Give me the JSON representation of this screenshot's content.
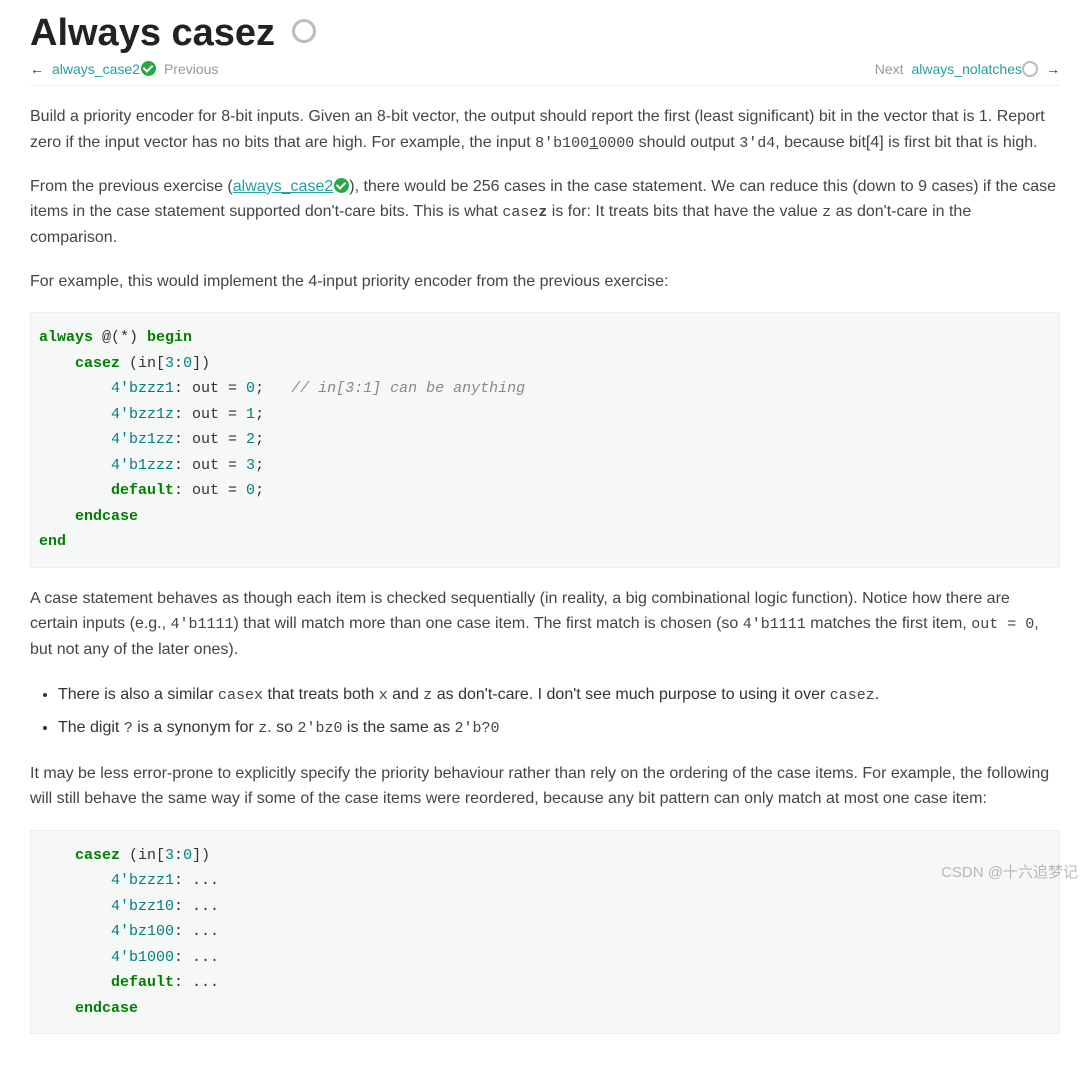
{
  "header": {
    "title": "Always casez"
  },
  "nav": {
    "prev_link": "always_case2",
    "prev_label": "Previous",
    "next_label": "Next",
    "next_link": "always_nolatches"
  },
  "paragraphs": {
    "p1_a": "Build a priority encoder for 8-bit inputs. Given an 8-bit vector, the output should report the first (least significant) bit in the vector that is 1. Report zero if the input vector has no bits that are high. For example, the input ",
    "p1_code1": "8'b100",
    "p1_code2": "1",
    "p1_code3": "0000",
    "p1_b": " should output ",
    "p1_code4": "3'd4",
    "p1_c": ", because bit[4] is first bit that is high.",
    "p2_a": "From the previous exercise (",
    "p2_link": "always_case2",
    "p2_b": "), there would be 256 cases in the case statement. We can reduce this (down to 9 cases) if the case items in the case statement supported don't-care bits. This is what ",
    "p2_code1": "case",
    "p2_code2": "z",
    "p2_c": " is for: It treats bits that have the value ",
    "p2_code3": "z",
    "p2_d": " as don't-care in the comparison.",
    "p3": "For example, this would implement the 4-input priority encoder from the previous exercise:",
    "p4_a": "A case statement behaves as though each item is checked sequentially (in reality, a big combinational logic function). Notice how there are certain inputs (e.g., ",
    "p4_code1": "4'b1111",
    "p4_b": ") that will match more than one case item. The first match is chosen (so ",
    "p4_code2": "4'b1111",
    "p4_c": " matches the first item, ",
    "p4_code3": "out = 0",
    "p4_d": ", but not any of the later ones).",
    "li1_a": "There is also a similar ",
    "li1_code1": "casex",
    "li1_b": " that treats both ",
    "li1_code2": "x",
    "li1_c": " and ",
    "li1_code3": "z",
    "li1_d": " as don't-care. I don't see much purpose to using it over ",
    "li1_code4": "casez",
    "li1_e": ".",
    "li2_a": "The digit ",
    "li2_code1": "?",
    "li2_b": " is a synonym for ",
    "li2_code2": "z",
    "li2_c": ". so ",
    "li2_code3": "2'bz0",
    "li2_d": " is the same as ",
    "li2_code4": "2'b?0",
    "p5": "It may be less error-prone to explicitly specify the priority behaviour rather than rely on the ordering of the case items. For example, the following will still behave the same way if some of the case items were reordered, because any bit pattern can only match at most one case item:"
  },
  "code1": {
    "l1_a": "always",
    "l1_b": " @(*) ",
    "l1_c": "begin",
    "l2_a": "    casez",
    "l2_b": " (in[",
    "l2_c": "3",
    "l2_d": ":",
    "l2_e": "0",
    "l2_f": "])",
    "l3_a": "        4'bzzz1",
    "l3_b": ": out = ",
    "l3_c": "0",
    "l3_d": ";   ",
    "l3_e": "// in[3:1] can be anything",
    "l4_a": "        4'bzz1z",
    "l4_b": ": out = ",
    "l4_c": "1",
    "l4_d": ";",
    "l5_a": "        4'bz1zz",
    "l5_b": ": out = ",
    "l5_c": "2",
    "l5_d": ";",
    "l6_a": "        4'b1zzz",
    "l6_b": ": out = ",
    "l6_c": "3",
    "l6_d": ";",
    "l7_a": "        default",
    "l7_b": ": out = ",
    "l7_c": "0",
    "l7_d": ";",
    "l8": "    endcase",
    "l9": "end"
  },
  "code2": {
    "l1_a": "    casez",
    "l1_b": " (in[",
    "l1_c": "3",
    "l1_d": ":",
    "l1_e": "0",
    "l1_f": "])",
    "l2_a": "        4'bzzz1",
    "l2_b": ": ...",
    "l3_a": "        4'bzz10",
    "l3_b": ": ...",
    "l4_a": "        4'bz100",
    "l4_b": ": ...",
    "l5_a": "        4'b1000",
    "l5_b": ": ...",
    "l6_a": "        default",
    "l6_b": ": ...",
    "l7": "    endcase"
  },
  "watermark": "CSDN @十六追梦记"
}
